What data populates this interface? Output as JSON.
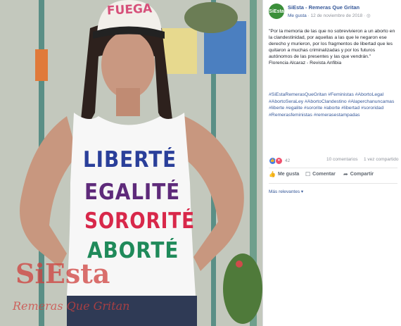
{
  "photo": {
    "cap_text": "FUEGA",
    "shirt_lines": [
      "LIBERTÉ",
      "EGALITÉ",
      "SORORITÉ",
      "ABORTÉ"
    ],
    "shirt_colors": [
      "#2a3f9a",
      "#5e2a7a",
      "#d8284a",
      "#1f8a5a"
    ],
    "watermark_brand": "SiEsta",
    "watermark_sub": "Remeras Que Gritan"
  },
  "post": {
    "avatar_text": "SiEsta",
    "page_name": "SiEsta - Remeras Que Gritan",
    "like_label": "Me gusta",
    "date": "· 12 de noviembre de 2018 ·",
    "quote": "\"Por la memoria de las que no sobrevivieron a un aborto en la clandestinidad, por aquellas a las que le negaron ese derecho y murieron, por los fragmentos de libertad que les quitaron a muchas criminalizadas y por los futuros autónomos de las presentes y las que vendrán.\"",
    "author": "Florencia Alcaraz - Revista Anfibia",
    "hashtags": "#SiEstaRemerasQueGritan #Feministas #AbortoLegal #AbortoSeraLey #AbortoClandestino #Alaperchanuncamas #liberte #egalite #sororite #aborte #libertad #sororidad #Remerasfeministas #remerasestampadas",
    "reactions_count": "42",
    "comments": "10 comentarios",
    "shares": "1 vez compartido",
    "actions": {
      "like": "Me gusta",
      "comment": "Comentar",
      "share": "Compartir"
    },
    "sort_label": "Más relevantes ▾"
  },
  "colors": {
    "link": "#365899",
    "avatar_bg": "#3b8f3a"
  }
}
